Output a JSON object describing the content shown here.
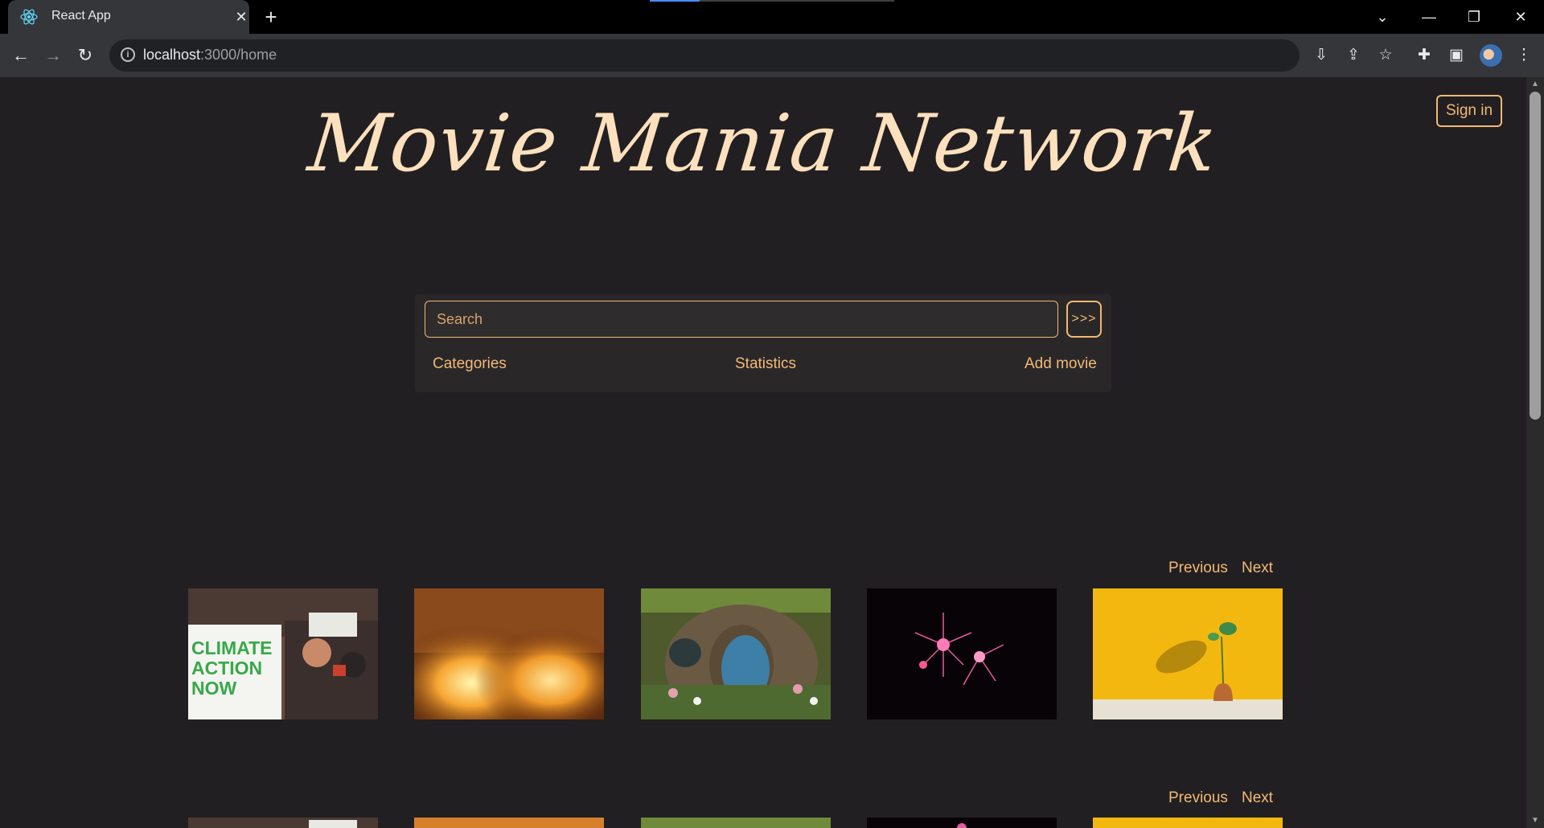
{
  "browser": {
    "tab_title": "React App",
    "tab_close": "✕",
    "new_tab": "+",
    "url_host": "localhost",
    "url_path": ":3000/home",
    "window_controls": {
      "minimize": "—",
      "restore": "❐",
      "close": "✕",
      "tab_search": "⌄"
    }
  },
  "header": {
    "logo_text": "Movie Mania Network",
    "signin_label": "Sign in"
  },
  "search": {
    "placeholder": "Search",
    "button_label": ">>>"
  },
  "nav": {
    "categories": "Categories",
    "statistics": "Statistics",
    "add_movie": "Add movie"
  },
  "carousels": [
    {
      "previous": "Previous",
      "next": "Next",
      "images": [
        "climate-protest",
        "fire-explosion",
        "hobbit-door",
        "fireworks",
        "plant-yellow-wall"
      ]
    },
    {
      "previous": "Previous",
      "next": "Next",
      "images": [
        "climate-protest",
        "fire-explosion",
        "hobbit-door",
        "fireworks",
        "plant-yellow-wall"
      ]
    }
  ],
  "thumb_texts": {
    "protest_sign": "CLIMATE ACTION NOW"
  },
  "colors": {
    "accent": "#f2b975",
    "logo": "#fde0bd",
    "background": "#211f21"
  }
}
